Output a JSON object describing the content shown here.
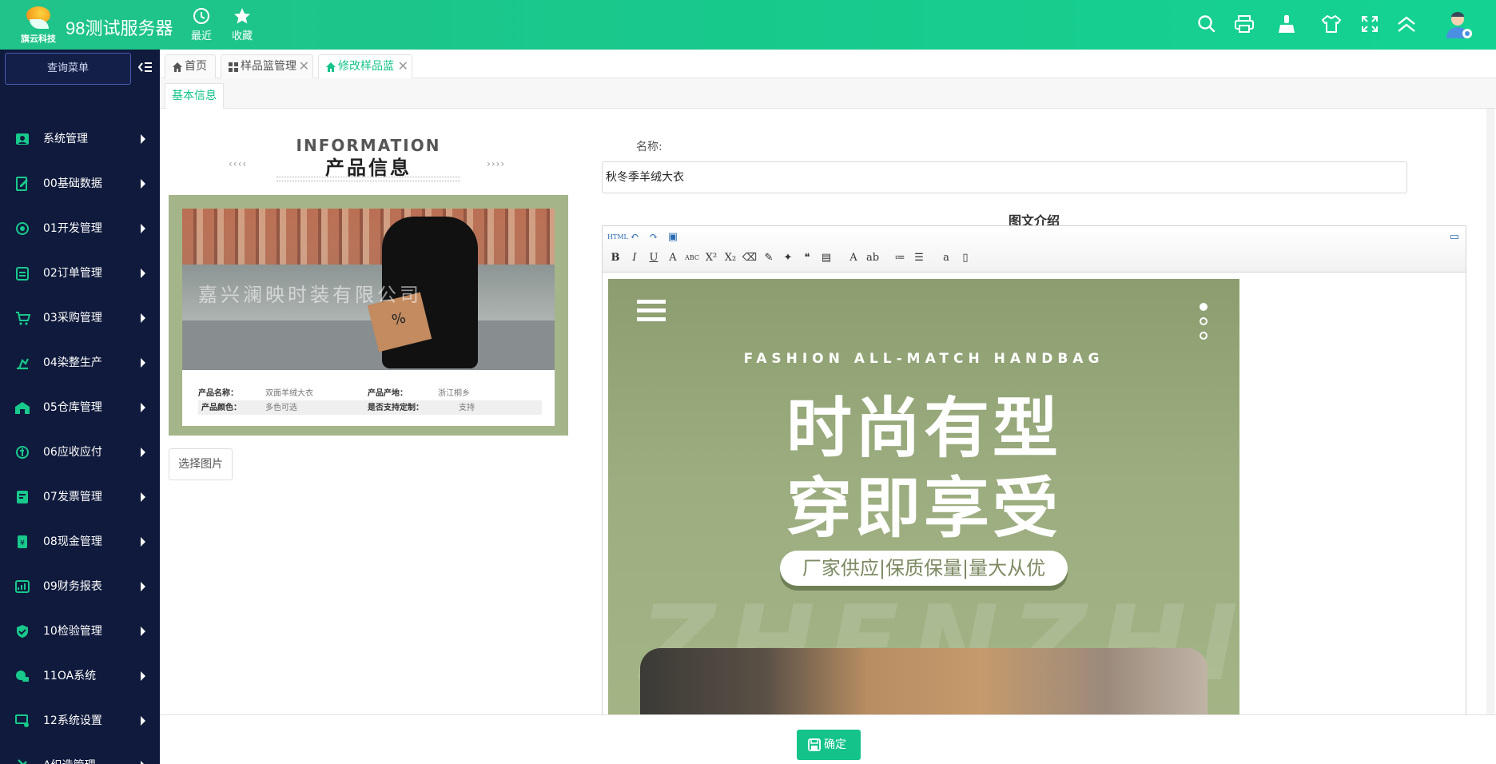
{
  "app": {
    "logo_text": "旗云科技",
    "title": "98测试服务器",
    "nav": [
      {
        "label": "最近",
        "icon": "clock-icon"
      },
      {
        "label": "收藏",
        "icon": "star-icon"
      }
    ],
    "right_icons": [
      "search-icon",
      "print-icon",
      "cleaner-icon",
      "shirt-icon",
      "fullscreen-icon",
      "collapse-up-icon",
      "admin-avatar-icon"
    ]
  },
  "sidebar": {
    "search_label": "查询菜单",
    "items": [
      {
        "label": "系统管理",
        "icon": "user-card-icon"
      },
      {
        "label": "00基础数据",
        "icon": "edit-doc-icon"
      },
      {
        "label": "01开发管理",
        "icon": "dev-icon"
      },
      {
        "label": "02订单管理",
        "icon": "clipboard-icon"
      },
      {
        "label": "03采购管理",
        "icon": "cart-icon"
      },
      {
        "label": "04染整生产",
        "icon": "machine-icon"
      },
      {
        "label": "05仓库管理",
        "icon": "warehouse-icon"
      },
      {
        "label": "06应收应付",
        "icon": "money-cycle-icon"
      },
      {
        "label": "07发票管理",
        "icon": "invoice-icon"
      },
      {
        "label": "08现金管理",
        "icon": "cash-icon"
      },
      {
        "label": "09财务报表",
        "icon": "report-icon"
      },
      {
        "label": "10检验管理",
        "icon": "shield-check-icon"
      },
      {
        "label": "11OA系统",
        "icon": "oa-icon"
      },
      {
        "label": "12系统设置",
        "icon": "settings-icon"
      },
      {
        "label": "A织造管理",
        "icon": "tools-icon"
      }
    ]
  },
  "tabs": [
    {
      "label": "首页",
      "icon": "home-icon",
      "closable": false
    },
    {
      "label": "样品篮管理",
      "icon": "grid-icon",
      "closable": true
    },
    {
      "label": "修改样品蓝",
      "icon": "home-icon",
      "closable": true,
      "active": true
    }
  ],
  "close_glyph": "✕",
  "subtab": "基本信息",
  "product_image": {
    "heading_en": "INFORMATION",
    "heading_cn": "产品信息",
    "chevrons_left": "‹‹‹‹",
    "chevrons_right": "››››",
    "bag_mark": "%",
    "watermark": "嘉兴澜映时装有限公司",
    "specs": [
      {
        "k1": "产品名称：",
        "v1": "双面羊绒大衣",
        "k2": "产品产地：",
        "v2": "浙江桐乡"
      },
      {
        "k1": "产品颜色：",
        "v1": "多色可选",
        "k2": "是否支持定制：",
        "v2": "支持"
      }
    ]
  },
  "choose_image_label": "选择图片",
  "form": {
    "name_label": "名称:",
    "name_value": "秋冬季羊绒大衣",
    "desc_label": "图文介绍"
  },
  "editor": {
    "toolbar_row1": [
      {
        "name": "html-source-icon",
        "glyph": "HTML"
      },
      {
        "name": "undo-icon",
        "glyph": "↶"
      },
      {
        "name": "redo-icon",
        "glyph": "↷"
      },
      {
        "name": "insert-image-icon",
        "glyph": "▣"
      }
    ],
    "toolbar_row2": [
      {
        "name": "bold-icon",
        "glyph": "B"
      },
      {
        "name": "italic-icon",
        "glyph": "I"
      },
      {
        "name": "underline-icon",
        "glyph": "U"
      },
      {
        "name": "font-border-icon",
        "glyph": "A"
      },
      {
        "name": "strikethrough-icon",
        "glyph": "ABC"
      },
      {
        "name": "superscript-icon",
        "glyph": "X²"
      },
      {
        "name": "subscript-icon",
        "glyph": "X₂"
      },
      {
        "name": "eraser-icon",
        "glyph": "⌫"
      },
      {
        "name": "format-brush-icon",
        "glyph": "✎"
      },
      {
        "name": "auto-format-icon",
        "glyph": "✦"
      },
      {
        "name": "blockquote-icon",
        "glyph": "❝"
      },
      {
        "name": "paste-plain-icon",
        "glyph": "▤"
      },
      {
        "name": "font-color-icon",
        "glyph": "A"
      },
      {
        "name": "highlight-icon",
        "glyph": "ab"
      },
      {
        "name": "ordered-list-icon",
        "glyph": "≔"
      },
      {
        "name": "unordered-list-icon",
        "glyph": "☰"
      },
      {
        "name": "anchor-icon",
        "glyph": "a"
      },
      {
        "name": "page-icon",
        "glyph": "▯"
      }
    ],
    "fullscreen_glyph": "▭",
    "banner": {
      "en": "FASHION ALL-MATCH HANDBAG",
      "line1": "时尚有型",
      "line2": "穿即享受",
      "tagline": "厂家供应|保质保量|量大从优",
      "ghost": "ZHENZHI"
    }
  },
  "footer": {
    "confirm_label": "确定"
  },
  "colors": {
    "accent": "#14c38a",
    "sidebar_bg": "#0f1a3c"
  }
}
